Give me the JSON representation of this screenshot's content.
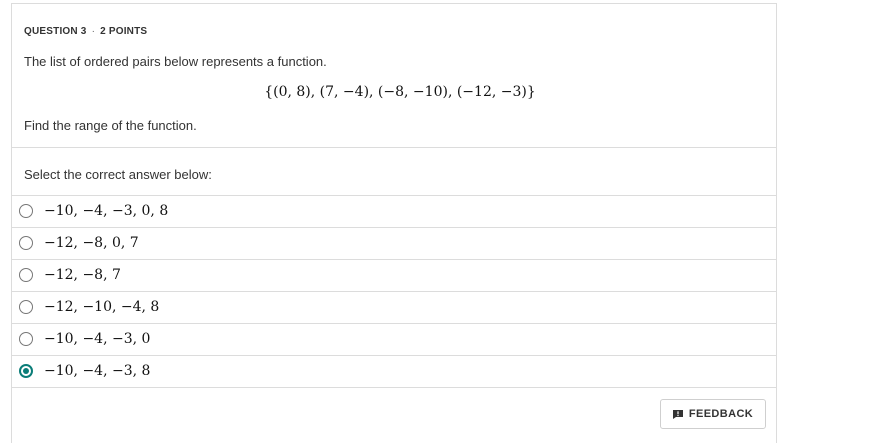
{
  "question": {
    "number_label": "QUESTION 3",
    "separator": "·",
    "points_label": "2 POINTS",
    "prompt": "The list of ordered pairs below represents a function.",
    "ordered_pairs": "{(0, 8), (7, −4), (−8, −10), (−12, −3)}",
    "task": "Find the range of the function."
  },
  "answers": {
    "instruction": "Select the correct answer below:",
    "options": [
      {
        "label": "−10, −4, −3, 0, 8",
        "selected": false
      },
      {
        "label": "−12, −8, 0, 7",
        "selected": false
      },
      {
        "label": "−12, −8, 7",
        "selected": false
      },
      {
        "label": "−12, −10, −4, 8",
        "selected": false
      },
      {
        "label": "−10, −4, −3, 0",
        "selected": false
      },
      {
        "label": "−10, −4, −3, 8",
        "selected": true
      }
    ]
  },
  "footer": {
    "feedback_label": "FEEDBACK",
    "feedback_icon": "comment-icon"
  },
  "colors": {
    "accent": "#0b7d78",
    "border": "#dcdcdc"
  }
}
